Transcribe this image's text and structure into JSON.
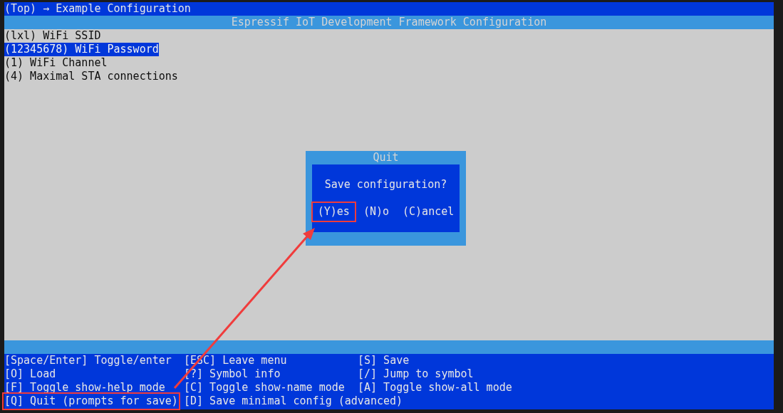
{
  "breadcrumb": "(Top) → Example Configuration",
  "header_title": "Espressif IoT Development Framework Configuration",
  "menu_items": [
    {
      "label": "(lxl) WiFi SSID",
      "selected": false
    },
    {
      "label": "(12345678) WiFi Password",
      "selected": true
    },
    {
      "label": "(1) WiFi Channel",
      "selected": false
    },
    {
      "label": "(4) Maximal STA connections",
      "selected": false
    }
  ],
  "dialog": {
    "title": "Quit",
    "message": "Save configuration?",
    "buttons": [
      {
        "label": "(Y)es",
        "highlighted": true
      },
      {
        "label": "(N)o",
        "highlighted": false
      },
      {
        "label": "(C)ancel",
        "highlighted": false
      }
    ]
  },
  "help": [
    {
      "label": "[Space/Enter] Toggle/enter",
      "highlighted": false
    },
    {
      "label": "[ESC] Leave menu",
      "highlighted": false
    },
    {
      "label": "[S] Save",
      "highlighted": false
    },
    {
      "label": "[O] Load",
      "highlighted": false
    },
    {
      "label": "[?] Symbol info",
      "highlighted": false
    },
    {
      "label": "[/] Jump to symbol",
      "highlighted": false
    },
    {
      "label": "[F] Toggle show-help mode",
      "highlighted": false
    },
    {
      "label": "[C] Toggle show-name mode",
      "highlighted": false
    },
    {
      "label": "[A] Toggle show-all mode",
      "highlighted": false
    },
    {
      "label": "[Q] Quit (prompts for save)",
      "highlighted": true
    },
    {
      "label": "[D] Save minimal config (advanced)",
      "highlighted": false
    }
  ]
}
